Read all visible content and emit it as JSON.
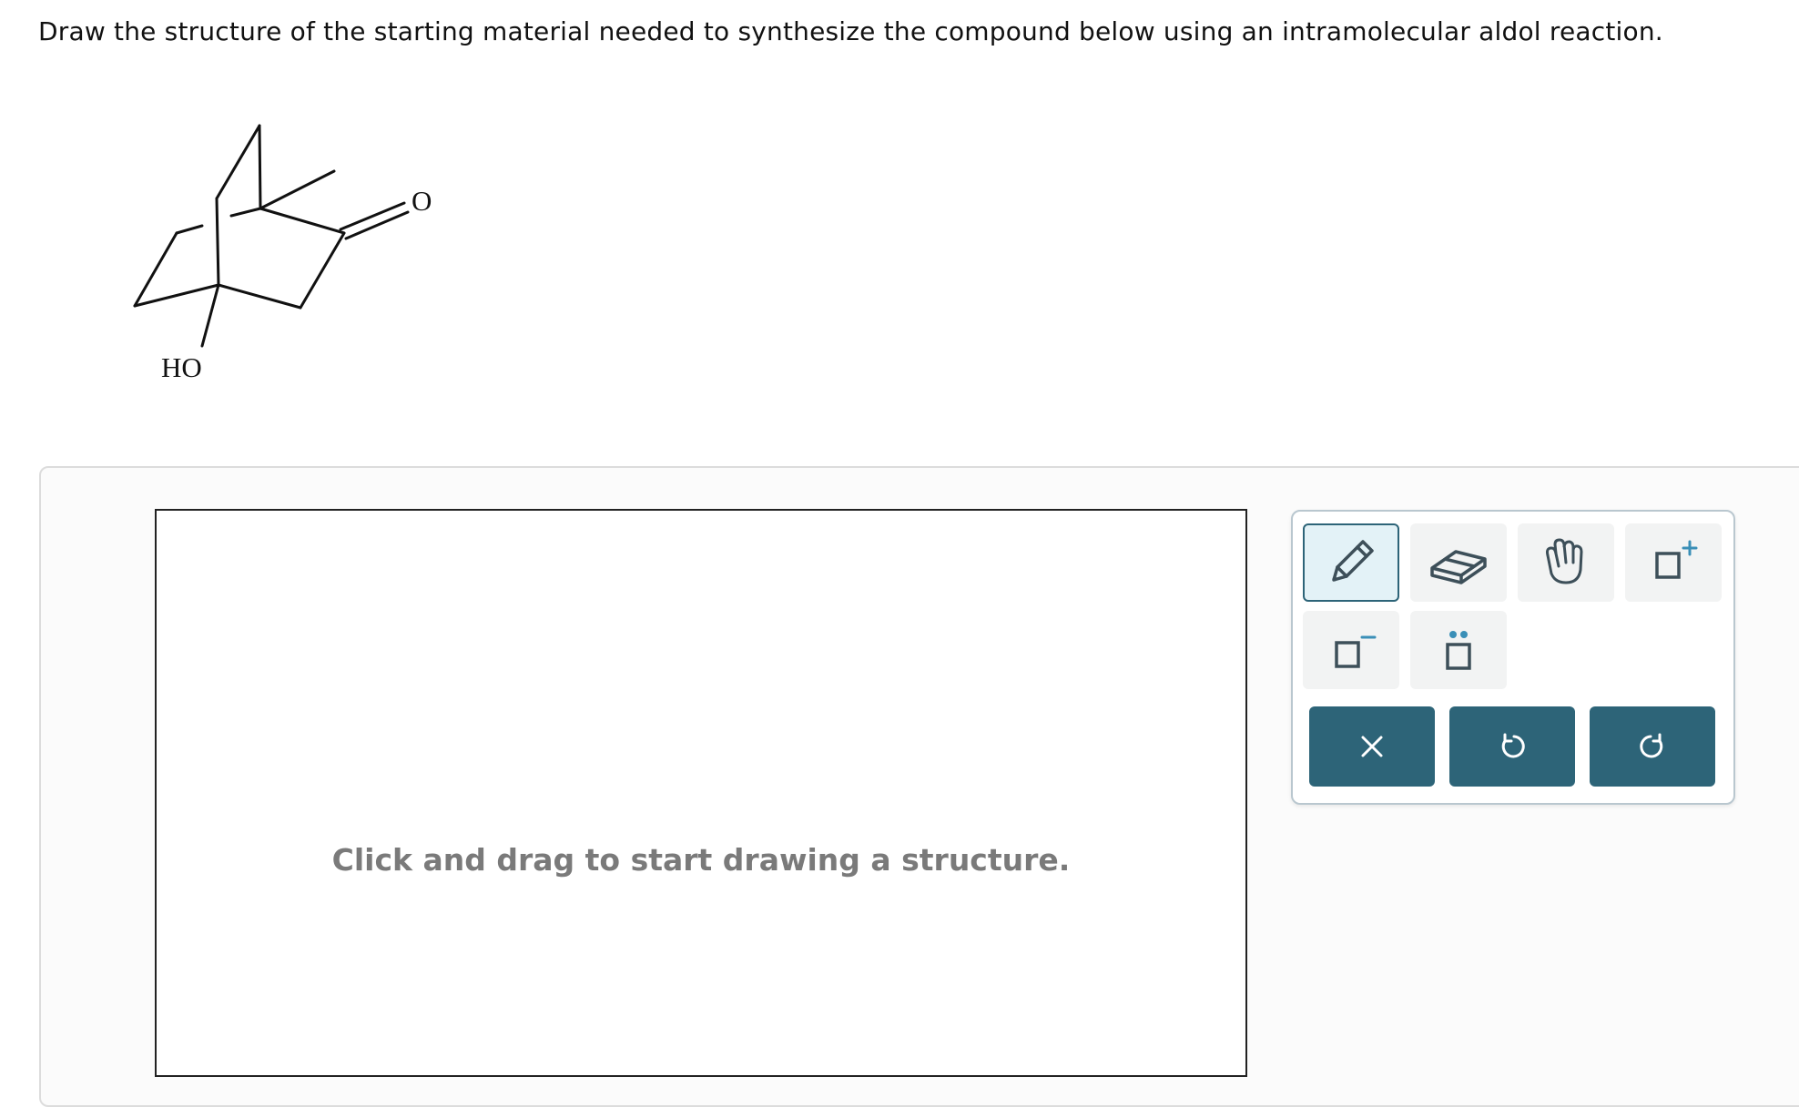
{
  "question": {
    "text": "Draw the structure of the starting material needed to synthesize the compound below using an intramolecular aldol reaction."
  },
  "molecule": {
    "atom_labels": {
      "carbonyl_oxygen": "O",
      "hydroxyl": "HO"
    }
  },
  "canvas": {
    "hint": "Click and drag to start drawing a structure."
  },
  "toolbar": {
    "tools": [
      {
        "icon": "pencil-icon",
        "active": true
      },
      {
        "icon": "eraser-icon",
        "active": false
      },
      {
        "icon": "hand-icon",
        "active": false
      },
      {
        "icon": "positive-charge-icon",
        "active": false
      },
      {
        "icon": "negative-charge-icon",
        "active": false
      },
      {
        "icon": "lone-pair-icon",
        "active": false
      }
    ],
    "actions": [
      {
        "icon": "clear-icon"
      },
      {
        "icon": "undo-icon"
      },
      {
        "icon": "redo-icon"
      }
    ],
    "colors": {
      "accent": "#2d6478",
      "active_tool_bg": "#e3f2f7",
      "tool_bg": "#f2f3f3",
      "charge_plus": "#3a8fb7"
    }
  }
}
